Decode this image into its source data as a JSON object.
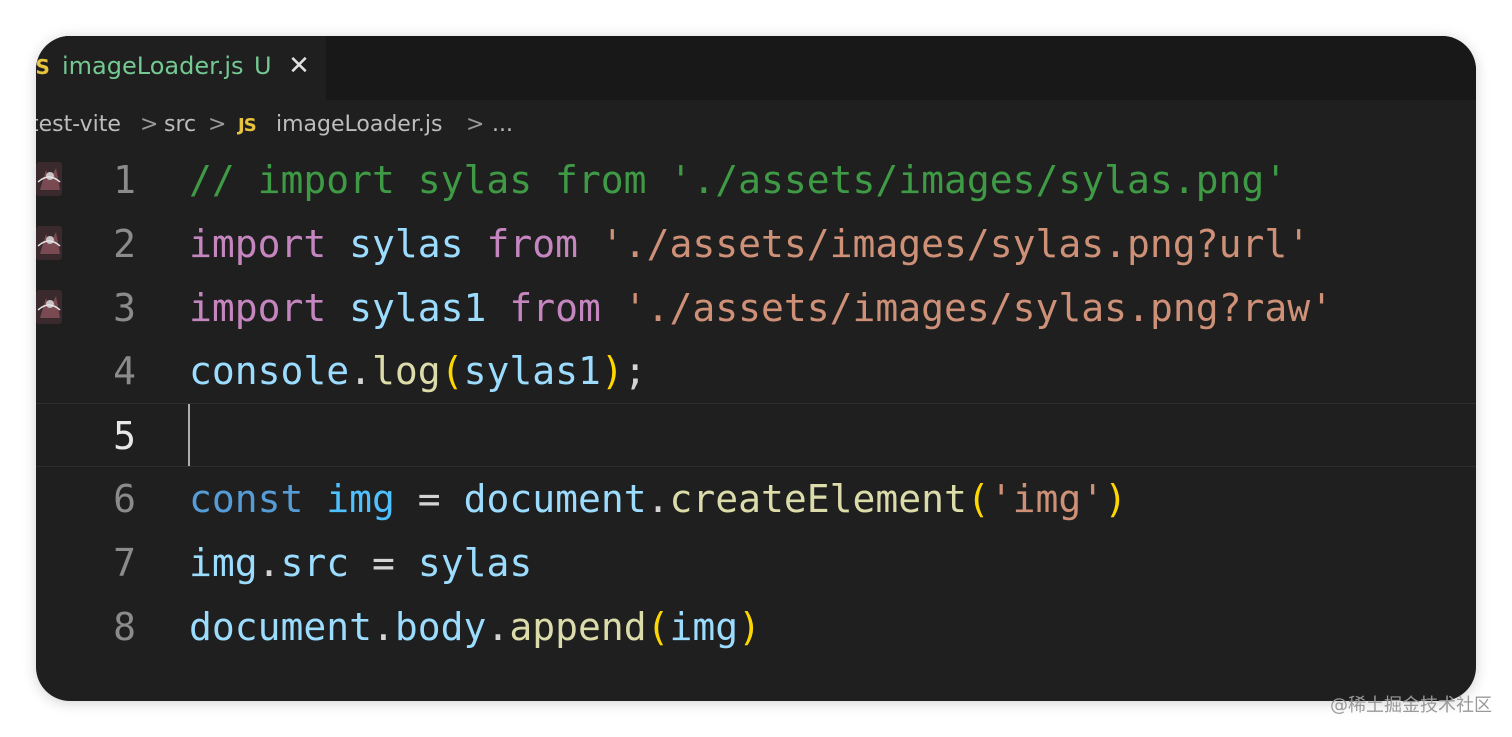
{
  "tab": {
    "icon": "js-file-icon",
    "icon_label": "JS",
    "filename": "imageLoader.js",
    "status": "U",
    "close_glyph": "✕"
  },
  "breadcrumb": {
    "items": [
      "test-vite",
      "src",
      "imageLoader.js",
      "..."
    ],
    "separator": ">",
    "file_icon_label": "JS"
  },
  "editor": {
    "current_line": 5,
    "line_numbers": [
      "1",
      "2",
      "3",
      "4",
      "5",
      "6",
      "7",
      "8"
    ],
    "lines": [
      {
        "tokens": [
          {
            "t": "// import sylas from './assets/images/sylas.png'",
            "k": "comment"
          }
        ],
        "gutter_image": true
      },
      {
        "tokens": [
          {
            "t": "import",
            "k": "kw"
          },
          {
            "t": " ",
            "k": "punc"
          },
          {
            "t": "sylas",
            "k": "var"
          },
          {
            "t": " ",
            "k": "punc"
          },
          {
            "t": "from",
            "k": "kw"
          },
          {
            "t": " ",
            "k": "punc"
          },
          {
            "t": "'./assets/images/sylas.png?url'",
            "k": "str"
          }
        ],
        "gutter_image": true
      },
      {
        "tokens": [
          {
            "t": "import",
            "k": "kw"
          },
          {
            "t": " ",
            "k": "punc"
          },
          {
            "t": "sylas1",
            "k": "var"
          },
          {
            "t": " ",
            "k": "punc"
          },
          {
            "t": "from",
            "k": "kw"
          },
          {
            "t": " ",
            "k": "punc"
          },
          {
            "t": "'./assets/images/sylas.png?raw'",
            "k": "str"
          }
        ],
        "gutter_image": true
      },
      {
        "tokens": [
          {
            "t": "console",
            "k": "var"
          },
          {
            "t": ".",
            "k": "punc"
          },
          {
            "t": "log",
            "k": "fn"
          },
          {
            "t": "(",
            "k": "brk"
          },
          {
            "t": "sylas1",
            "k": "var"
          },
          {
            "t": ")",
            "k": "brk"
          },
          {
            "t": ";",
            "k": "punc"
          }
        ],
        "gutter_image": false
      },
      {
        "tokens": [],
        "gutter_image": false
      },
      {
        "tokens": [
          {
            "t": "const",
            "k": "storage"
          },
          {
            "t": " ",
            "k": "punc"
          },
          {
            "t": "img",
            "k": "const"
          },
          {
            "t": " = ",
            "k": "punc"
          },
          {
            "t": "document",
            "k": "var"
          },
          {
            "t": ".",
            "k": "punc"
          },
          {
            "t": "createElement",
            "k": "fn"
          },
          {
            "t": "(",
            "k": "brk"
          },
          {
            "t": "'img'",
            "k": "str"
          },
          {
            "t": ")",
            "k": "brk"
          }
        ],
        "gutter_image": false
      },
      {
        "tokens": [
          {
            "t": "img",
            "k": "var"
          },
          {
            "t": ".",
            "k": "punc"
          },
          {
            "t": "src",
            "k": "var"
          },
          {
            "t": " = ",
            "k": "punc"
          },
          {
            "t": "sylas",
            "k": "var"
          }
        ],
        "gutter_image": false
      },
      {
        "tokens": [
          {
            "t": "document",
            "k": "var"
          },
          {
            "t": ".",
            "k": "punc"
          },
          {
            "t": "body",
            "k": "var"
          },
          {
            "t": ".",
            "k": "punc"
          },
          {
            "t": "append",
            "k": "fn"
          },
          {
            "t": "(",
            "k": "brk"
          },
          {
            "t": "img",
            "k": "var"
          },
          {
            "t": ")",
            "k": "brk"
          }
        ],
        "gutter_image": false
      }
    ]
  },
  "colors": {
    "background": "#1f1f1f",
    "comment": "#3f9a45",
    "keyword": "#c586c0",
    "variable": "#9cdcfe",
    "string": "#ce9178",
    "function": "#dcdcaa",
    "bracket": "#ffd700",
    "storage": "#569cd6",
    "git_untracked": "#73c991"
  },
  "watermark": "@稀土掘金技术社区"
}
